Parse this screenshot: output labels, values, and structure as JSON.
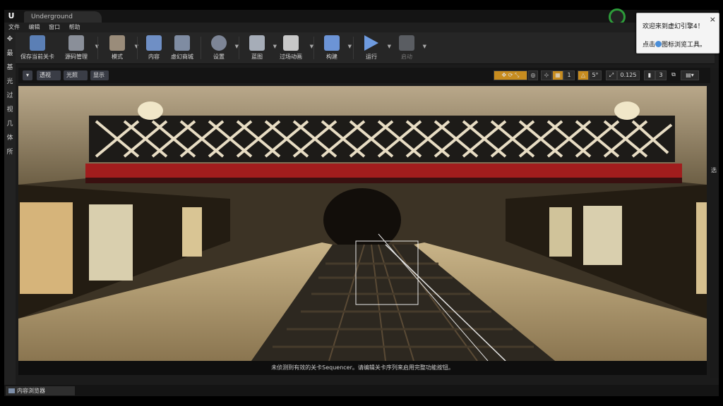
{
  "window": {
    "tab_title": "Underground",
    "logo": "U",
    "minimize": "—",
    "close_glyph": "×"
  },
  "menu": [
    "文件",
    "编辑",
    "窗口",
    "帮助"
  ],
  "toolbar": {
    "save_current_level": "保存当前关卡",
    "source_control": "源码管理",
    "modes": "模式",
    "content": "内容",
    "marketplace": "虚幻商城",
    "settings": "设置",
    "blueprints": "蓝图",
    "cinematics": "过场动画",
    "build": "构建",
    "play": "运行",
    "launch": "启动"
  },
  "left_strip": [
    "最",
    "基",
    "光",
    "过",
    "视",
    "几",
    "体",
    "所"
  ],
  "viewport_bar": {
    "perspective": "透视",
    "lit": "光照",
    "show": "显示",
    "snap_grid_value": "1",
    "snap_rotation_value": "5°",
    "snap_scale_value": "0.125",
    "camera_speed": "3"
  },
  "notice": "未侦测到有效的关卡Sequencer。请编辑关卡序列来启用完整功能按钮。",
  "content_browser_tab": "内容浏览器",
  "popup": {
    "line1": "欢迎来到虚幻引擎4！",
    "line2_prefix": "点击",
    "line2_suffix": "图标浏览工具。",
    "close": "×"
  },
  "right_strip_label": "选",
  "icons": [
    "save-icon",
    "source-control-icon",
    "modes-icon",
    "content-icon",
    "marketplace-icon",
    "settings-icon",
    "blueprints-icon",
    "cinematics-icon",
    "build-icon",
    "play-icon",
    "launch-icon"
  ]
}
